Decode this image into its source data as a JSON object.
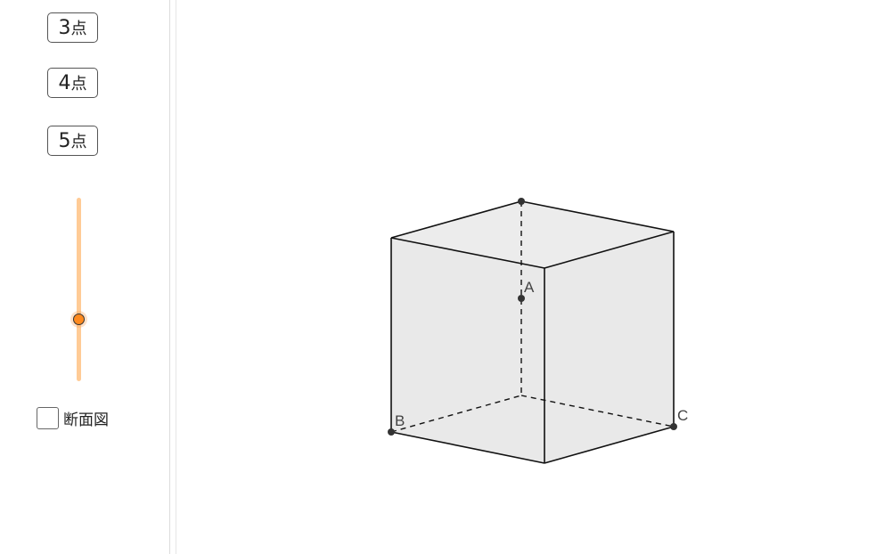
{
  "sidebar": {
    "buttons": [
      {
        "number": "3",
        "suffix": "点"
      },
      {
        "number": "4",
        "suffix": "点"
      },
      {
        "number": "5",
        "suffix": "点"
      }
    ],
    "slider": {
      "value_fraction": 0.66,
      "color": "#ff8a1f"
    },
    "checkbox": {
      "label": "断面図",
      "checked": false
    }
  },
  "figure": {
    "points": {
      "A": "A",
      "B": "B",
      "C": "C"
    },
    "face_color": "#e9e9e9",
    "edge_color": "#111111"
  }
}
